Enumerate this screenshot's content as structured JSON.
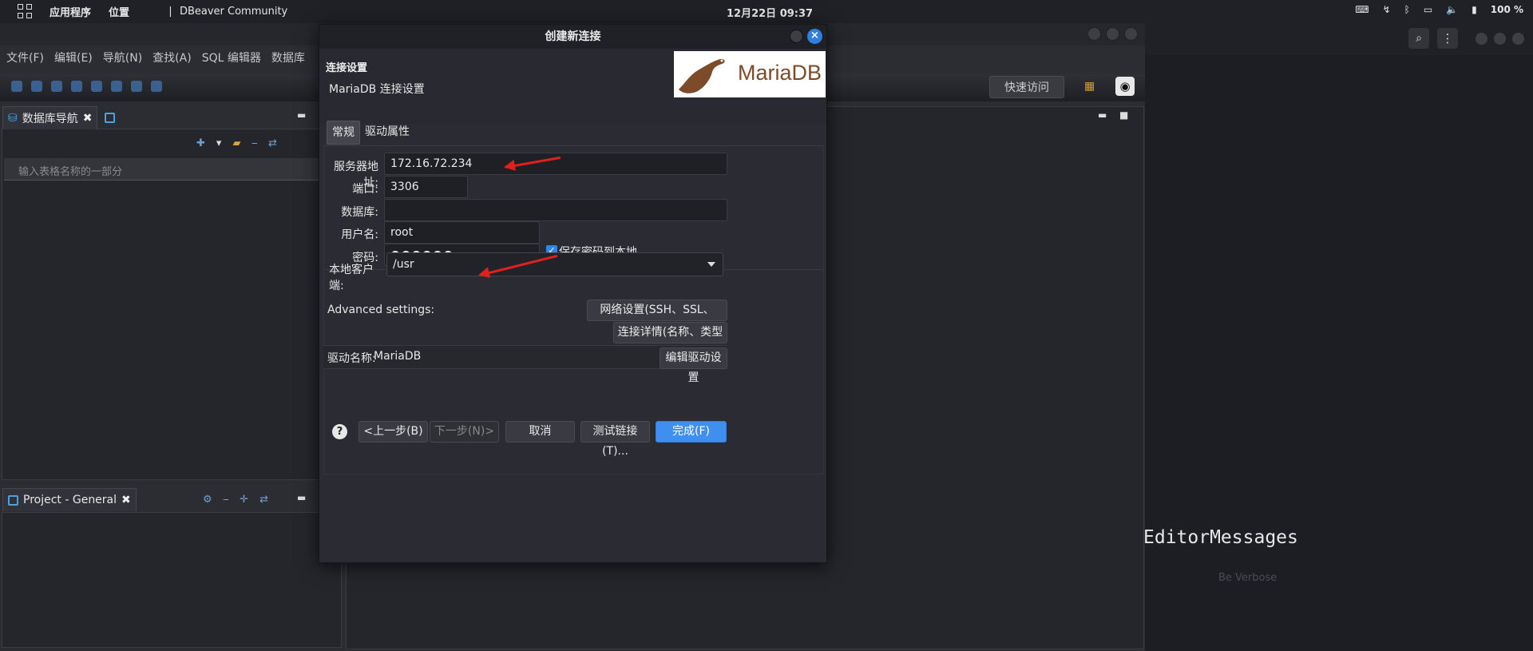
{
  "topbar": {
    "apps_menu": "应用程序",
    "places_menu": "位置",
    "active_app": "DBeaver Community",
    "clock": "12月22日 09:37",
    "battery": "100 %"
  },
  "ide": {
    "menu": [
      "文件(F)",
      "编辑(E)",
      "导航(N)",
      "查找(A)",
      "SQL 编辑器",
      "数据库"
    ],
    "quick_access": "快速访问",
    "db_nav_tab": "数据库导航",
    "db_nav_search_placeholder": "输入表格名称的一部分",
    "project_tab": "Project - General",
    "editor_messages": "EditorMessages",
    "be_verbose": "Be Verbose"
  },
  "dialog": {
    "title": "创建新连接",
    "section_title": "连接设置",
    "section_subtitle": "MariaDB 连接设置",
    "logo_text": "MariaDB",
    "tabs": [
      "常规",
      "驱动属性"
    ],
    "fields": {
      "host_label": "服务器地址:",
      "host_value": "172.16.72.234",
      "port_label": "端口:",
      "port_value": "3306",
      "database_label": "数据库:",
      "database_value": "",
      "user_label": "用户名:",
      "user_value": "root",
      "password_label": "密码:",
      "password_value": "●●●●●●",
      "save_password": "保存密码到本地",
      "save_password_checked": true,
      "local_client_label": "本地客户端:",
      "local_client_value": "/usr"
    },
    "advanced_label": "Advanced settings:",
    "network_button": "网络设置(SSH、SSL、Proxy...)",
    "conn_details_button": "连接详情(名称、类型 ... )",
    "driver_label": "驱动名称:",
    "driver_value": "MariaDB",
    "edit_driver_button": "编辑驱动设置",
    "buttons": {
      "back": "<上一步(B)",
      "next": "下一步(N)>",
      "cancel": "取消",
      "test": "测试链接(T)...",
      "finish": "完成(F)"
    }
  },
  "colors": {
    "accent": "#3f8ff0",
    "annotation_arrow": "#e0201c"
  }
}
